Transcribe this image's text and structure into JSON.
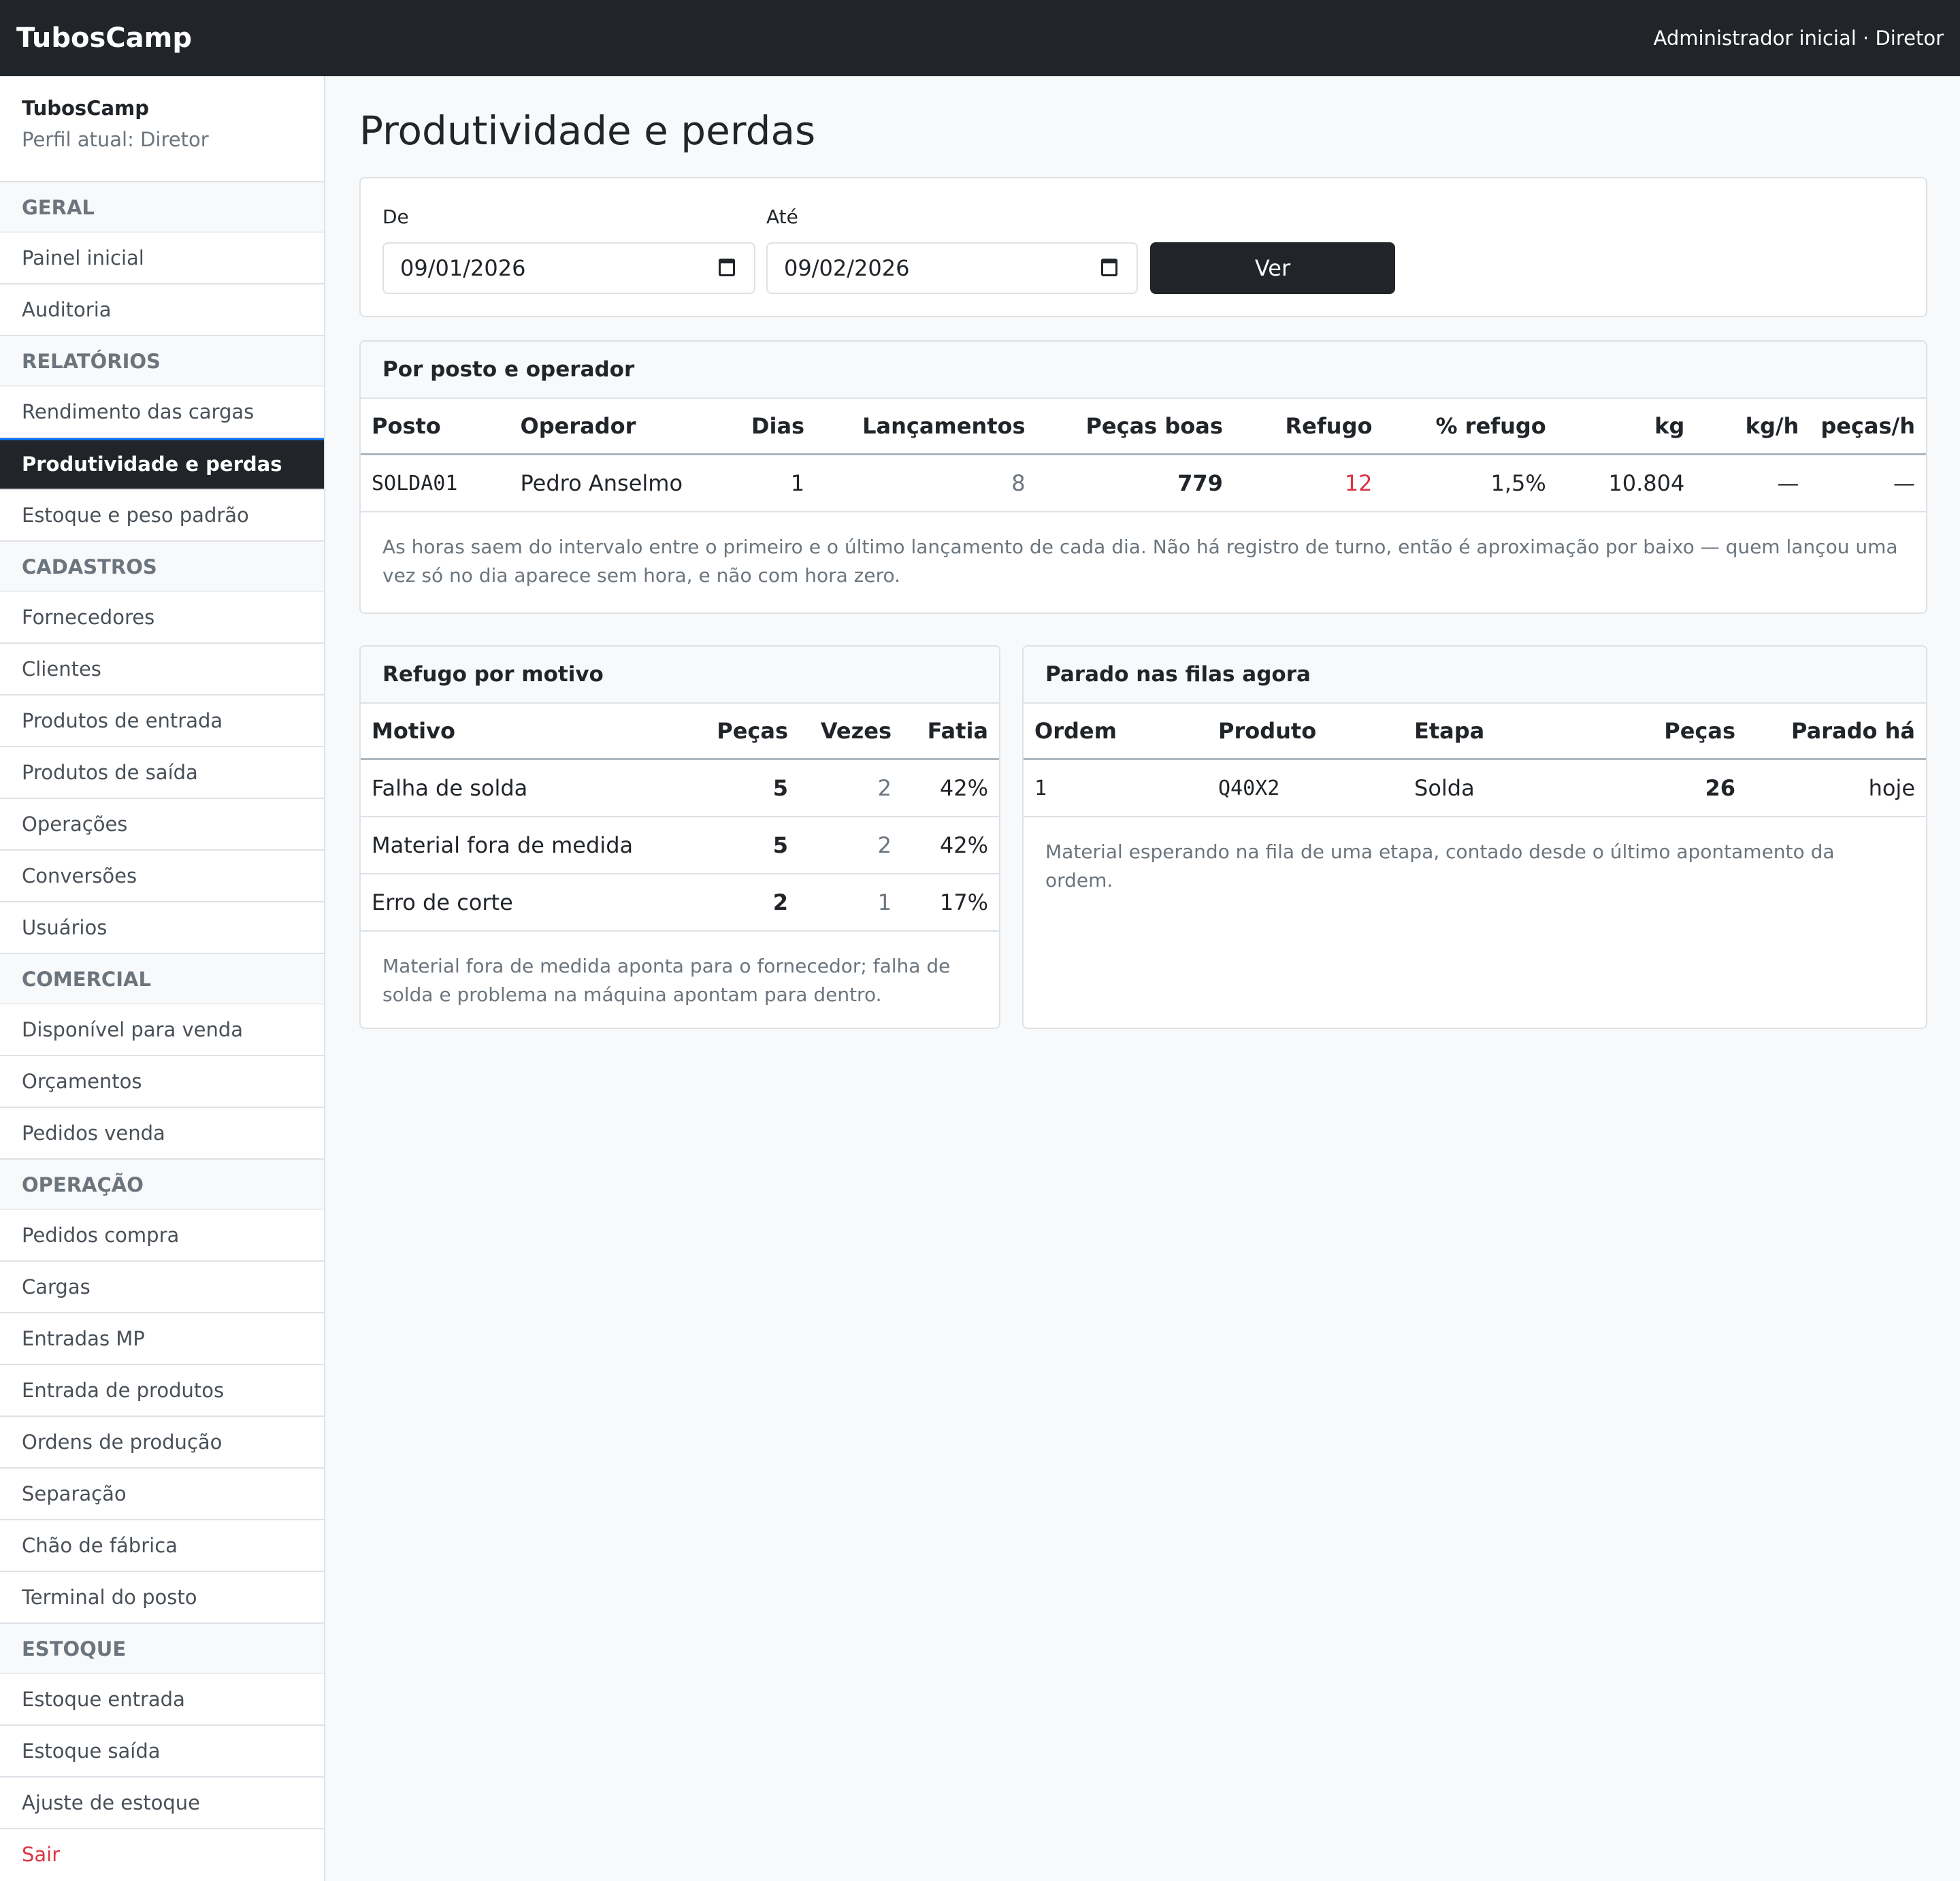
{
  "topbar": {
    "brand": "TubosCamp",
    "user": "Administrador inicial · Diretor"
  },
  "sidebar": {
    "header": {
      "title": "TubosCamp",
      "profile": "Perfil atual: Diretor"
    },
    "groups": [
      {
        "title": "GERAL",
        "items": [
          "Painel inicial",
          "Auditoria"
        ]
      },
      {
        "title": "RELATÓRIOS",
        "items": [
          "Rendimento das cargas",
          "Produtividade e perdas",
          "Estoque e peso padrão"
        ]
      },
      {
        "title": "CADASTROS",
        "items": [
          "Fornecedores",
          "Clientes",
          "Produtos de entrada",
          "Produtos de saída",
          "Operações",
          "Conversões",
          "Usuários"
        ]
      },
      {
        "title": "COMERCIAL",
        "items": [
          "Disponível para venda",
          "Orçamentos",
          "Pedidos venda"
        ]
      },
      {
        "title": "OPERAÇÃO",
        "items": [
          "Pedidos compra",
          "Cargas",
          "Entradas MP",
          "Entrada de produtos",
          "Ordens de produção",
          "Separação",
          "Chão de fábrica",
          "Terminal do posto"
        ]
      },
      {
        "title": "ESTOQUE",
        "items": [
          "Estoque entrada",
          "Estoque saída",
          "Ajuste de estoque"
        ]
      }
    ],
    "active_item": "Produtividade e perdas",
    "logout": "Sair"
  },
  "page": {
    "title": "Produtividade e perdas"
  },
  "filter": {
    "from_label": "De",
    "from_value": "09/01/2026",
    "to_label": "Até",
    "to_value": "09/02/2026",
    "submit_label": "Ver"
  },
  "by_station": {
    "title": "Por posto e operador",
    "columns": [
      "Posto",
      "Operador",
      "Dias",
      "Lançamentos",
      "Peças boas",
      "Refugo",
      "% refugo",
      "kg",
      "kg/h",
      "peças/h"
    ],
    "rows": [
      {
        "posto": "SOLDA01",
        "operador": "Pedro Anselmo",
        "dias": "1",
        "lancamentos": "8",
        "pecas_boas": "779",
        "refugo": "12",
        "pct_refugo": "1,5%",
        "kg": "10.804",
        "kg_h": "—",
        "pecas_h": "—"
      }
    ],
    "note": "As horas saem do intervalo entre o primeiro e o último lançamento de cada dia. Não há registro de turno, então é aproximação por baixo — quem lançou uma vez só no dia aparece sem hora, e não com hora zero."
  },
  "scrap_by_reason": {
    "title": "Refugo por motivo",
    "columns": [
      "Motivo",
      "Peças",
      "Vezes",
      "Fatia"
    ],
    "rows": [
      {
        "motivo": "Falha de solda",
        "pecas": "5",
        "vezes": "2",
        "fatia": "42%"
      },
      {
        "motivo": "Material fora de medida",
        "pecas": "5",
        "vezes": "2",
        "fatia": "42%"
      },
      {
        "motivo": "Erro de corte",
        "pecas": "2",
        "vezes": "1",
        "fatia": "17%"
      }
    ],
    "note": "Material fora de medida aponta para o fornecedor; falha de solda e problema na máquina apontam para dentro."
  },
  "queues": {
    "title": "Parado nas filas agora",
    "columns": [
      "Ordem",
      "Produto",
      "Etapa",
      "Peças",
      "Parado há"
    ],
    "rows": [
      {
        "ordem": "1",
        "produto": "Q40X2",
        "etapa": "Solda",
        "pecas": "26",
        "parado": "hoje"
      }
    ],
    "note": "Material esperando na fila de uma etapa, contado desde o último apontamento da ordem."
  },
  "colors": {
    "dark": "#212529",
    "muted": "#6c757d",
    "danger": "#dc3545",
    "accent": "#0d6efd"
  }
}
